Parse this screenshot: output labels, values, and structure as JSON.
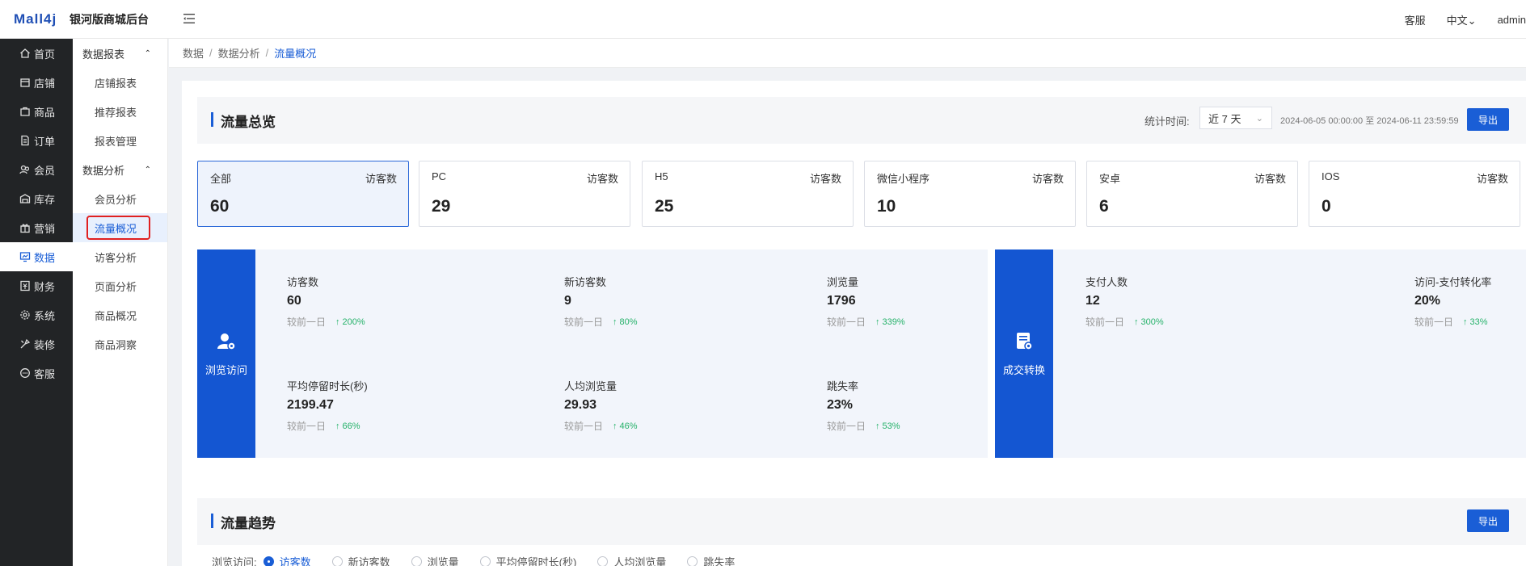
{
  "header": {
    "logo": "Mall4j",
    "site_title": "银河版商城后台",
    "service": "客服",
    "language": "中文",
    "user": "admin"
  },
  "nav_primary": [
    {
      "label": "首页",
      "icon": "home-icon"
    },
    {
      "label": "店铺",
      "icon": "shop-icon"
    },
    {
      "label": "商品",
      "icon": "goods-icon"
    },
    {
      "label": "订单",
      "icon": "order-icon"
    },
    {
      "label": "会员",
      "icon": "member-icon"
    },
    {
      "label": "库存",
      "icon": "stock-icon"
    },
    {
      "label": "营销",
      "icon": "gift-icon"
    },
    {
      "label": "数据",
      "icon": "chart-icon"
    },
    {
      "label": "财务",
      "icon": "finance-icon"
    },
    {
      "label": "系统",
      "icon": "gear-icon"
    },
    {
      "label": "装修",
      "icon": "decorate-icon"
    },
    {
      "label": "客服",
      "icon": "chat-icon"
    }
  ],
  "nav_secondary": {
    "group1": "数据报表",
    "group1_items": [
      "店铺报表",
      "推荐报表",
      "报表管理"
    ],
    "group2": "数据分析",
    "group2_items": [
      "会员分析",
      "流量概况",
      "访客分析",
      "页面分析",
      "商品概况",
      "商品洞察"
    ]
  },
  "breadcrumb": [
    "数据",
    "数据分析",
    "流量概况"
  ],
  "overview": {
    "title": "流量总览",
    "stat_time_label": "统计时间:",
    "range_select": "近 7 天",
    "date_range": "2024-06-05 00:00:00 至 2024-06-11 23:59:59",
    "export": "导出"
  },
  "channels": [
    {
      "name": "全部",
      "label": "访客数",
      "value": "60"
    },
    {
      "name": "PC",
      "label": "访客数",
      "value": "29"
    },
    {
      "name": "H5",
      "label": "访客数",
      "value": "25"
    },
    {
      "name": "微信小程序",
      "label": "访客数",
      "value": "10"
    },
    {
      "name": "安卓",
      "label": "访客数",
      "value": "6"
    },
    {
      "name": "IOS",
      "label": "访客数",
      "value": "0"
    }
  ],
  "browse_block": {
    "tag": "浏览访问",
    "metrics": [
      {
        "name": "访客数",
        "value": "60",
        "compare": "较前一日",
        "pct": "200%"
      },
      {
        "name": "新访客数",
        "value": "9",
        "compare": "较前一日",
        "pct": "80%"
      },
      {
        "name": "浏览量",
        "value": "1796",
        "compare": "较前一日",
        "pct": "339%"
      },
      {
        "name": "平均停留时长(秒)",
        "value": "2199.47",
        "compare": "较前一日",
        "pct": "66%"
      },
      {
        "name": "人均浏览量",
        "value": "29.93",
        "compare": "较前一日",
        "pct": "46%"
      },
      {
        "name": "跳失率",
        "value": "23%",
        "compare": "较前一日",
        "pct": "53%"
      }
    ]
  },
  "deal_block": {
    "tag": "成交转换",
    "metrics": [
      {
        "name": "支付人数",
        "value": "12",
        "compare": "较前一日",
        "pct": "300%"
      },
      {
        "name": "访问-支付转化率",
        "value": "20%",
        "compare": "较前一日",
        "pct": "33%"
      }
    ]
  },
  "trend": {
    "title": "流量趋势",
    "export": "导出",
    "radio_label": "浏览访问:",
    "options": [
      "访客数",
      "新访客数",
      "浏览量",
      "平均停留时长(秒)",
      "人均浏览量",
      "跳失率"
    ],
    "selected": "访客数"
  },
  "colors": {
    "accent": "#1a5ed6",
    "up": "#26b26a",
    "nav_dark": "#222426"
  }
}
